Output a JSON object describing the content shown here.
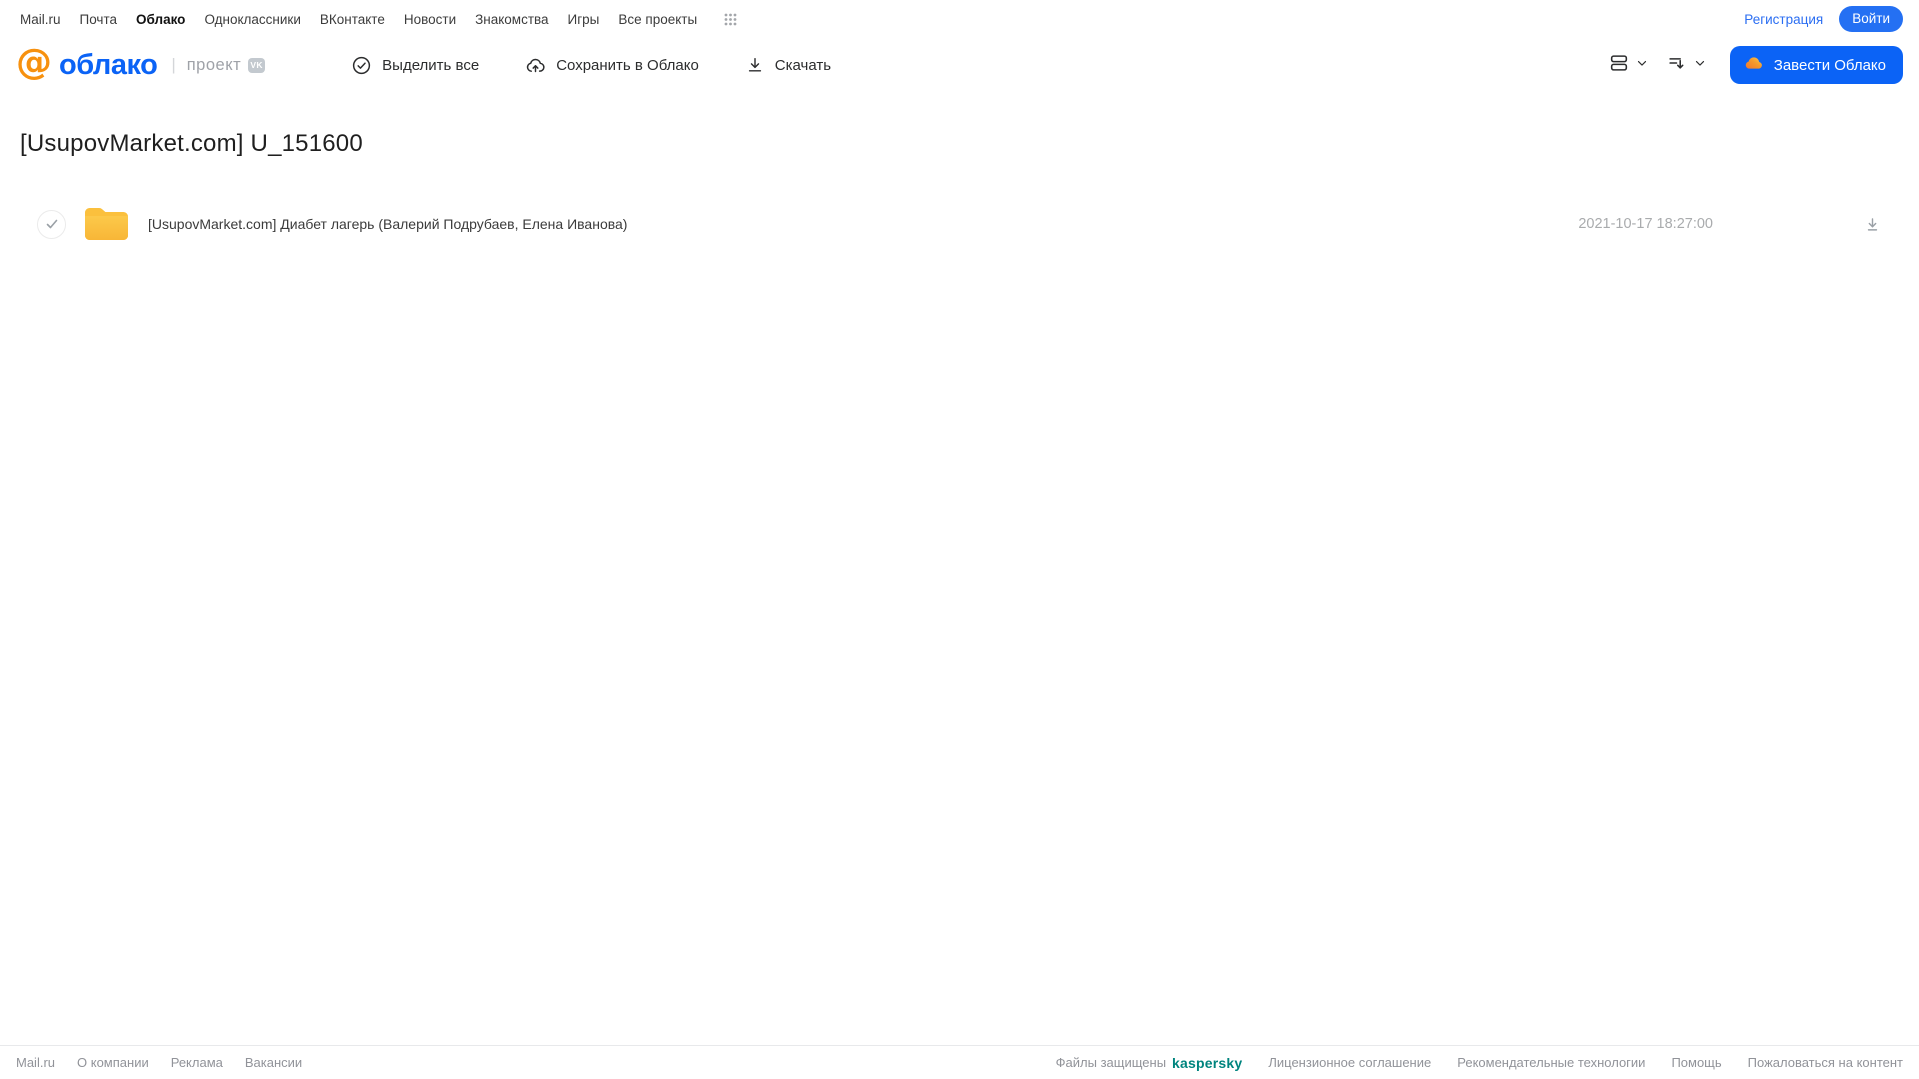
{
  "topnav": {
    "items": [
      {
        "label": "Mail.ru",
        "active": false
      },
      {
        "label": "Почта",
        "active": false
      },
      {
        "label": "Облако",
        "active": true
      },
      {
        "label": "Одноклассники",
        "active": false
      },
      {
        "label": "ВКонтакте",
        "active": false
      },
      {
        "label": "Новости",
        "active": false
      },
      {
        "label": "Знакомства",
        "active": false
      },
      {
        "label": "Игры",
        "active": false
      },
      {
        "label": "Все проекты",
        "active": false
      }
    ],
    "registration_label": "Регистрация",
    "login_label": "Войти"
  },
  "header": {
    "logo_at": "@",
    "logo_text": "облако",
    "divider": "|",
    "project_label": "проект",
    "vk_badge": "VK",
    "actions": {
      "select_all": "Выделить все",
      "save_to_cloud": "Сохранить в Облако",
      "download": "Скачать"
    },
    "create_cloud_label": "Завести Облако"
  },
  "main": {
    "title": "[UsupovMarket.com] U_151600",
    "files": [
      {
        "name": "[UsupovMarket.com] Диабет лагерь (Валерий Подрубаев, Елена Иванова)",
        "date": "2021-10-17 18:27:00",
        "type": "folder"
      }
    ]
  },
  "footer": {
    "left_links": [
      "Mail.ru",
      "О компании",
      "Реклама",
      "Вакансии"
    ],
    "protected_label": "Файлы защищены",
    "kaspersky_label": "kaspersky",
    "right_links": [
      "Лицензионное соглашение",
      "Рекомендательные технологии",
      "Помощь",
      "Пожаловаться на контент"
    ]
  },
  "colors": {
    "accent_blue": "#0b63f6",
    "logo_orange": "#f7910f",
    "folder_yellow": "#fbc23c",
    "kaspersky_teal": "#00847e"
  }
}
